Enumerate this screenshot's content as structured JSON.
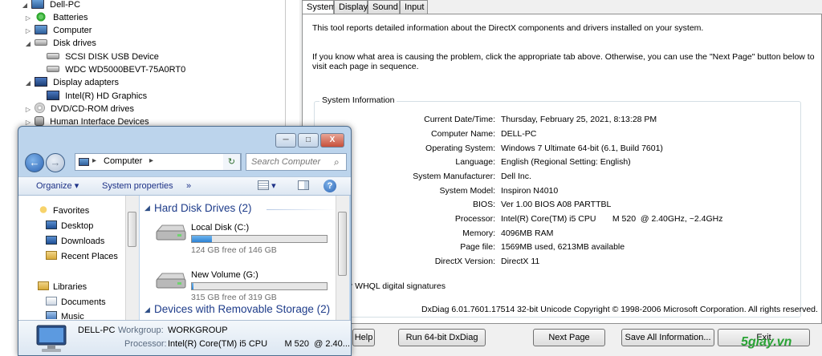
{
  "device_manager": {
    "items": [
      {
        "label": "Dell-PC",
        "arrow": "◢"
      },
      {
        "label": "Batteries",
        "arrow": "▷"
      },
      {
        "label": "Computer",
        "arrow": "▷"
      },
      {
        "label": "Disk drives",
        "arrow": "◢"
      },
      {
        "label": "SCSI DISK USB Device",
        "arrow": ""
      },
      {
        "label": "WDC WD5000BEVT-75A0RT0",
        "arrow": ""
      },
      {
        "label": "Display adapters",
        "arrow": "◢"
      },
      {
        "label": "Intel(R) HD Graphics",
        "arrow": ""
      },
      {
        "label": "DVD/CD-ROM drives",
        "arrow": "▷"
      },
      {
        "label": "Human Interface Devices",
        "arrow": "▷"
      }
    ]
  },
  "dxdiag": {
    "tabs": [
      "System",
      "Display",
      "Sound",
      "Input"
    ],
    "intro1": "This tool reports detailed information about the DirectX components and drivers installed on your system.",
    "intro2a": "If you know what area is causing the problem, click the appropriate tab above.  Otherwise, you can use the \"Next Page\" button below to",
    "intro2b": "visit each page in sequence.",
    "sysinfo_title": "System Information",
    "rows": [
      {
        "label": "Current Date/Time:",
        "value": "Thursday, February 25, 2021, 8:13:28 PM"
      },
      {
        "label": "Computer Name:",
        "value": "DELL-PC"
      },
      {
        "label": "Operating System:",
        "value": "Windows 7 Ultimate 64-bit (6.1, Build 7601)"
      },
      {
        "label": "Language:",
        "value": "English (Regional Setting: English)"
      },
      {
        "label": "System Manufacturer:",
        "value": "Dell Inc."
      },
      {
        "label": "System Model:",
        "value": "Inspiron N4010"
      },
      {
        "label": "BIOS:",
        "value": "Ver 1.00 BIOS A08 PARTTBL"
      },
      {
        "label": "Processor:",
        "value": "Intel(R) Core(TM) i5 CPU       M 520  @ 2.40GHz, ~2.4GHz"
      },
      {
        "label": "Memory:",
        "value": "4096MB RAM"
      },
      {
        "label": "Page file:",
        "value": "1569MB used, 6213MB available"
      },
      {
        "label": "DirectX Version:",
        "value": "DirectX 11"
      }
    ],
    "whql": "for WHQL digital signatures",
    "footer": "DxDiag 6.01.7601.17514 32-bit Unicode  Copyright © 1998-2006 Microsoft Corporation.  All rights reserved.",
    "buttons": {
      "help": "Help",
      "run64": "Run 64-bit DxDiag",
      "next": "Next Page",
      "save": "Save All Information...",
      "exit": "Exit"
    }
  },
  "explorer": {
    "caption": {
      "minimize": "─",
      "maximize": "□",
      "close": "X"
    },
    "back_glyph": "←",
    "forward_glyph": "→",
    "address": "Computer",
    "address_sep": "▸",
    "refresh_glyph": "↻",
    "search_placeholder": "Search Computer",
    "toolbar": {
      "organize": "Organize",
      "system_properties": "System properties",
      "more": "»",
      "dropdown": "▾",
      "help": "?"
    },
    "nav": {
      "favorites": "Favorites",
      "desktop": "Desktop",
      "downloads": "Downloads",
      "recent": "Recent Places",
      "libraries": "Libraries",
      "documents": "Documents",
      "music": "Music"
    },
    "groups": {
      "hdd": "Hard Disk Drives (2)",
      "removable": "Devices with Removable Storage (2)"
    },
    "drives": [
      {
        "name": "Local Disk (C:)",
        "free_text": "124 GB free of 146 GB",
        "used_fraction": 0.15
      },
      {
        "name": "New Volume (G:)",
        "free_text": "315 GB free of 319 GB",
        "used_fraction": 0.0125
      }
    ],
    "details": {
      "pc_name": "DELL-PC",
      "workgroup_label": "Workgroup:",
      "workgroup": "WORKGROUP",
      "processor_label": "Processor:",
      "processor": "Intel(R) Core(TM) i5 CPU       M 520  @ 2.40..."
    }
  },
  "watermark": "5giay.vn"
}
